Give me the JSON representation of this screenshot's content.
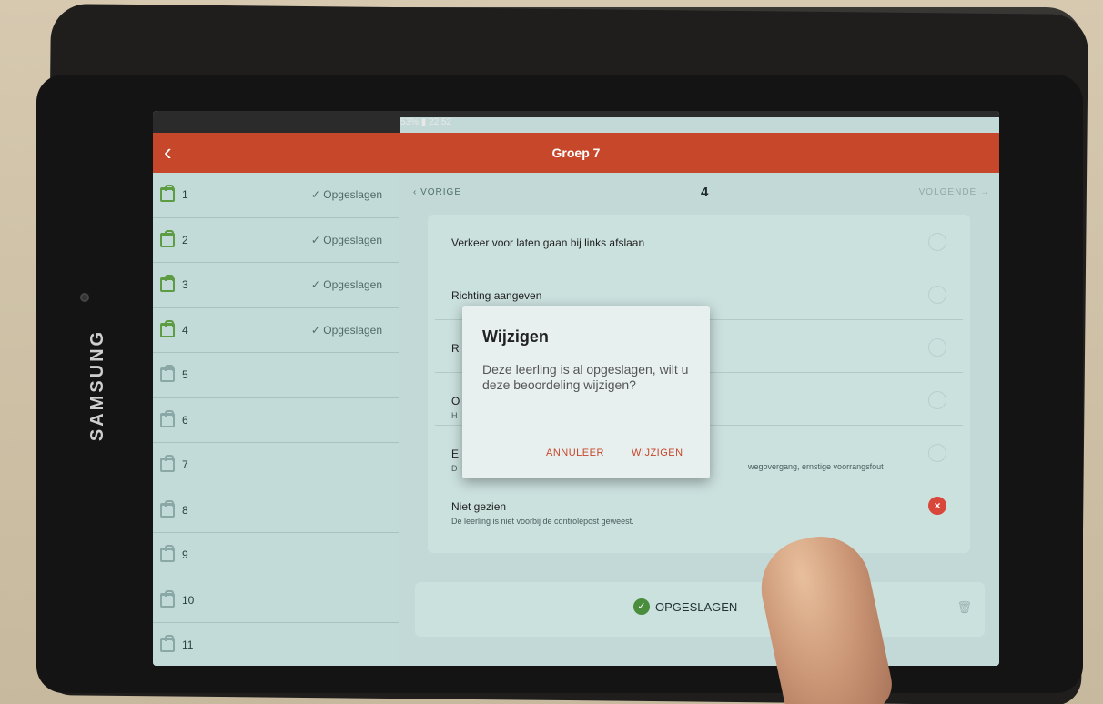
{
  "device": {
    "brand": "SAMSUNG"
  },
  "status_bar": {
    "battery": "53%",
    "time": "22:52"
  },
  "app_bar": {
    "back_icon": "chevron-left-icon",
    "title": "Groep 7"
  },
  "students": [
    {
      "number": "1",
      "status": "✓ Opgeslagen",
      "saved": true
    },
    {
      "number": "2",
      "status": "✓ Opgeslagen",
      "saved": true
    },
    {
      "number": "3",
      "status": "✓ Opgeslagen",
      "saved": true
    },
    {
      "number": "4",
      "status": "✓ Opgeslagen",
      "saved": true
    },
    {
      "number": "5",
      "status": "",
      "saved": false
    },
    {
      "number": "6",
      "status": "",
      "saved": false
    },
    {
      "number": "7",
      "status": "",
      "saved": false
    },
    {
      "number": "8",
      "status": "",
      "saved": false
    },
    {
      "number": "9",
      "status": "",
      "saved": false
    },
    {
      "number": "10",
      "status": "",
      "saved": false
    },
    {
      "number": "11",
      "status": "",
      "saved": false
    }
  ],
  "nav": {
    "prev": "VORIGE",
    "current": "4",
    "next": "VOLGENDE →"
  },
  "criteria": [
    {
      "label": "Verkeer voor laten gaan bij links afslaan",
      "desc": ""
    },
    {
      "label": "Richting aangeven",
      "desc": ""
    },
    {
      "label": "R",
      "desc": ""
    },
    {
      "label": "O",
      "desc": "H"
    },
    {
      "label": "E",
      "desc": "D",
      "desc_right": "wegovergang, ernstige voorrangsfout"
    },
    {
      "label": "Niet gezien",
      "desc": "De leerling is niet voorbij de controlepost geweest.",
      "selected": true
    }
  ],
  "save_button": {
    "label": "OPGESLAGEN",
    "icon": "check-circle-icon"
  },
  "trash_icon": "trash-icon",
  "dialog": {
    "title": "Wijzigen",
    "body": "Deze leerling is al opgeslagen, wilt u deze beoordeling wijzigen?",
    "cancel": "ANNULEER",
    "confirm": "WIJZIGEN"
  },
  "colors": {
    "accent": "#c7472b",
    "saved_green": "#5d9c43",
    "screen_bg": "#c2d9d7"
  }
}
